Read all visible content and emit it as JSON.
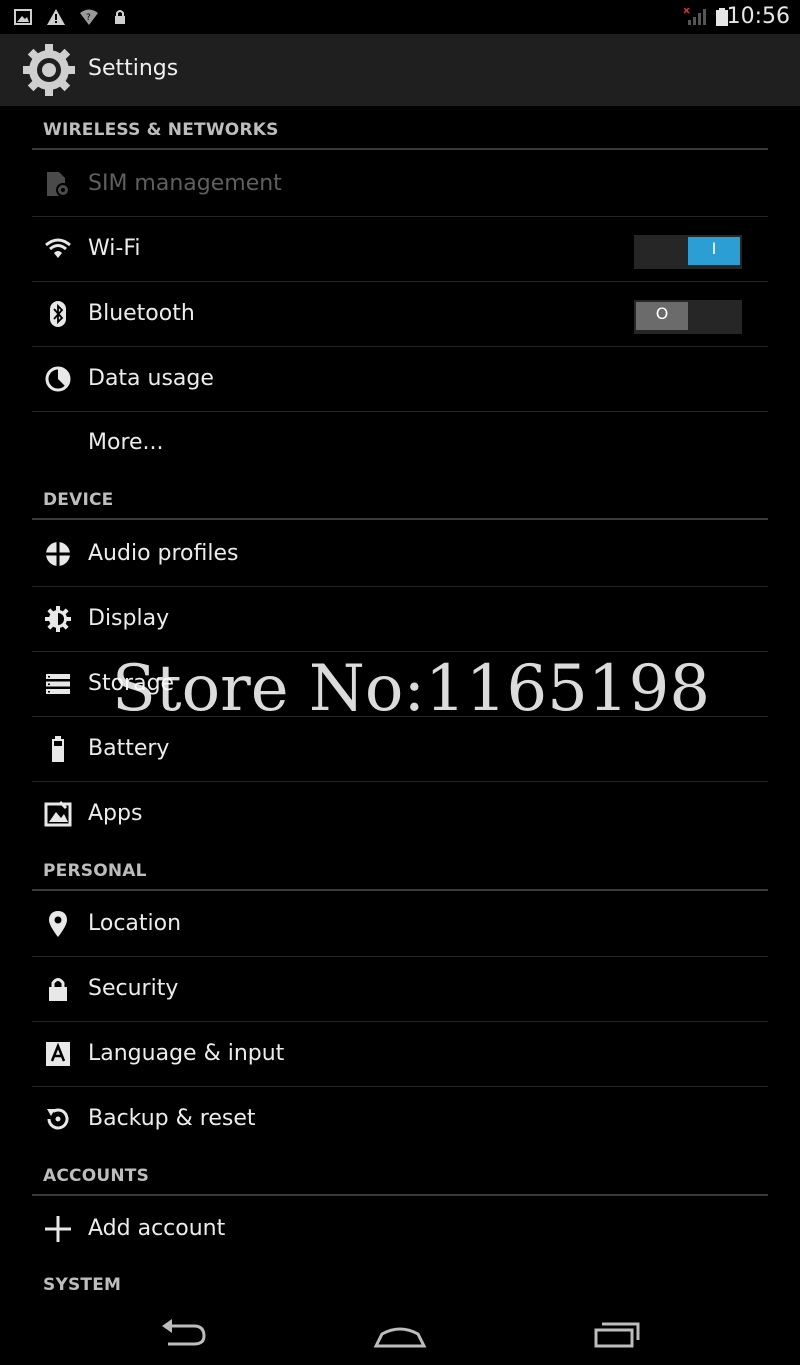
{
  "status_bar": {
    "time": "10:56"
  },
  "action_bar": {
    "title": "Settings"
  },
  "sections": {
    "wireless": "WIRELESS & NETWORKS",
    "device": "DEVICE",
    "personal": "PERSONAL",
    "accounts": "ACCOUNTS",
    "system": "SYSTEM"
  },
  "items": {
    "sim": {
      "label": "SIM management",
      "icon": "sim-icon",
      "enabled": false
    },
    "wifi": {
      "label": "Wi-Fi",
      "icon": "wifi-icon",
      "toggle": "on",
      "toggle_mark": "I"
    },
    "bluetooth": {
      "label": "Bluetooth",
      "icon": "bluetooth-icon",
      "toggle": "off",
      "toggle_mark": "O"
    },
    "data_usage": {
      "label": "Data usage",
      "icon": "data-usage-icon"
    },
    "more": {
      "label": "More..."
    },
    "audio": {
      "label": "Audio profiles",
      "icon": "audio-profiles-icon"
    },
    "display": {
      "label": "Display",
      "icon": "display-icon"
    },
    "storage": {
      "label": "Storage",
      "icon": "storage-icon"
    },
    "battery": {
      "label": "Battery",
      "icon": "battery-icon"
    },
    "apps": {
      "label": "Apps",
      "icon": "apps-icon"
    },
    "location": {
      "label": "Location",
      "icon": "location-icon"
    },
    "security": {
      "label": "Security",
      "icon": "lock-icon"
    },
    "language": {
      "label": "Language & input",
      "icon": "language-icon"
    },
    "backup": {
      "label": "Backup & reset",
      "icon": "backup-icon"
    },
    "add_account": {
      "label": "Add account",
      "icon": "plus-icon"
    }
  },
  "watermark": "Store No:1165198",
  "colors": {
    "accent": "#2b9fd4",
    "background": "#000000",
    "action_bar": "#1f1f1f"
  }
}
